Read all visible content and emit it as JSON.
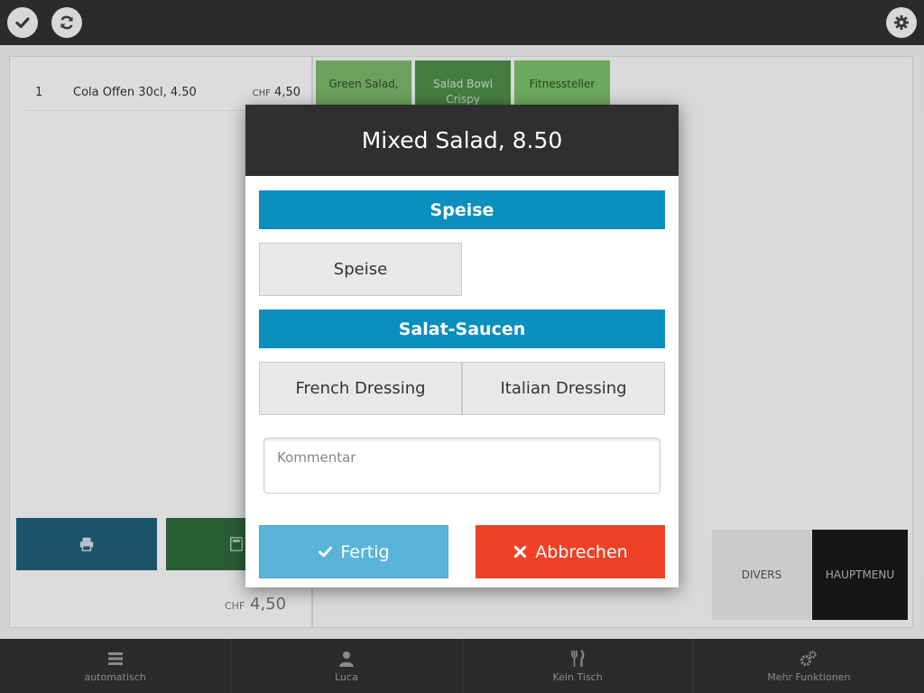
{
  "topbar": {
    "left_icons": [
      "checkmark-icon",
      "refresh-icon"
    ],
    "right_icons": [
      "gear-icon"
    ]
  },
  "order": {
    "items": [
      {
        "qty": "1",
        "name": "Cola Offen 30cl, 4.50",
        "currency": "CHF",
        "price": "4,50"
      }
    ],
    "total_currency": "CHF",
    "total": "4,50"
  },
  "products": {
    "tiles": [
      "Green Salad,",
      "Salad Bowl Crispy",
      "Fitnessteller"
    ]
  },
  "actions": {
    "divers": "DIVERS",
    "hauptmenu": "HAUPTMENU"
  },
  "bottombar": {
    "items": [
      {
        "label": "automatisch",
        "icon": "menu-icon"
      },
      {
        "label": "Luca",
        "icon": "user-icon"
      },
      {
        "label": "Kein Tisch",
        "icon": "cutlery-icon"
      },
      {
        "label": "Mehr Funktionen",
        "icon": "gears-icon"
      }
    ]
  },
  "modal": {
    "title": "Mixed Salad, 8.50",
    "sections": [
      {
        "header": "Speise",
        "options": [
          "Speise"
        ]
      },
      {
        "header": "Salat-Saucen",
        "options": [
          "French Dressing",
          "Italian Dressing"
        ]
      }
    ],
    "comment_placeholder": "Kommentar",
    "confirm_label": "Fertig",
    "cancel_label": "Abbrechen"
  },
  "colors": {
    "section_blue": "#0a8fbe",
    "confirm": "#5ab4da",
    "cancel": "#ef4126",
    "dark_bar": "#2b2b2b"
  }
}
